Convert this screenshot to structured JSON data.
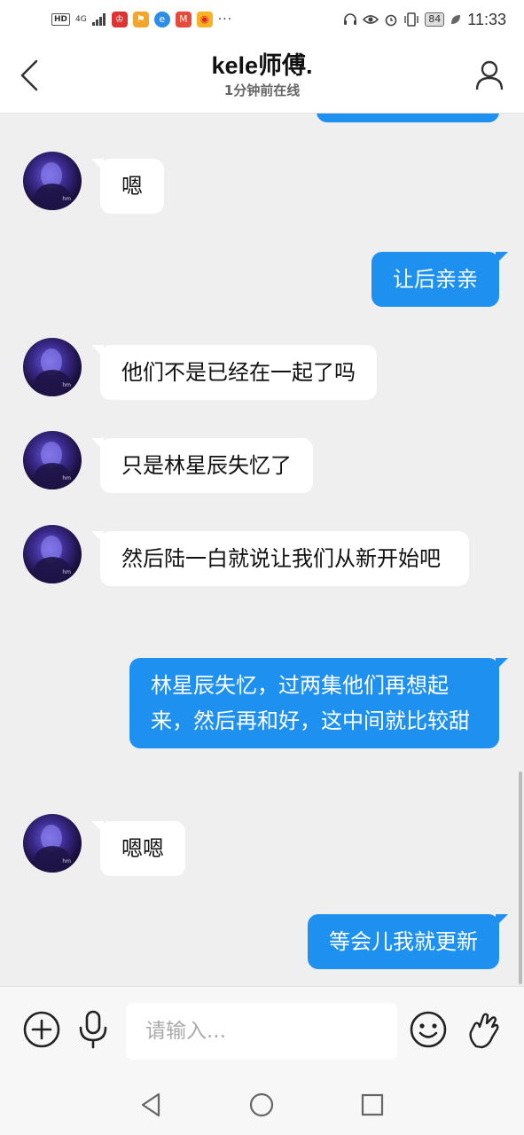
{
  "status_bar": {
    "hd": "HD",
    "signal": "4G",
    "battery": "84",
    "time": "11:33",
    "dots": "···",
    "icons": [
      "headset-icon",
      "eye-icon",
      "alarm-icon",
      "vibrate-icon",
      "leaf-icon"
    ]
  },
  "header": {
    "title": "kele师傅.",
    "subtitle": "1分钟前在线"
  },
  "messages": [
    {
      "side": "left",
      "text": "嗯"
    },
    {
      "side": "right",
      "text": "让后亲亲"
    },
    {
      "side": "left",
      "text": "他们不是已经在一起了吗"
    },
    {
      "side": "left",
      "text": "只是林星辰失忆了"
    },
    {
      "side": "left",
      "text": "然后陆一白就说让我们从新开始吧"
    },
    {
      "side": "right",
      "text": "林星辰失忆，过两集他们再想起来，然后再和好，这中间就比较甜"
    },
    {
      "side": "left",
      "text": "嗯嗯"
    },
    {
      "side": "right",
      "text": "等会儿我就更新"
    }
  ],
  "input_bar": {
    "placeholder": "请输入..."
  },
  "colors": {
    "accent": "#1e90f0",
    "chat_bg": "#efefef",
    "bubble_left": "#ffffff"
  }
}
